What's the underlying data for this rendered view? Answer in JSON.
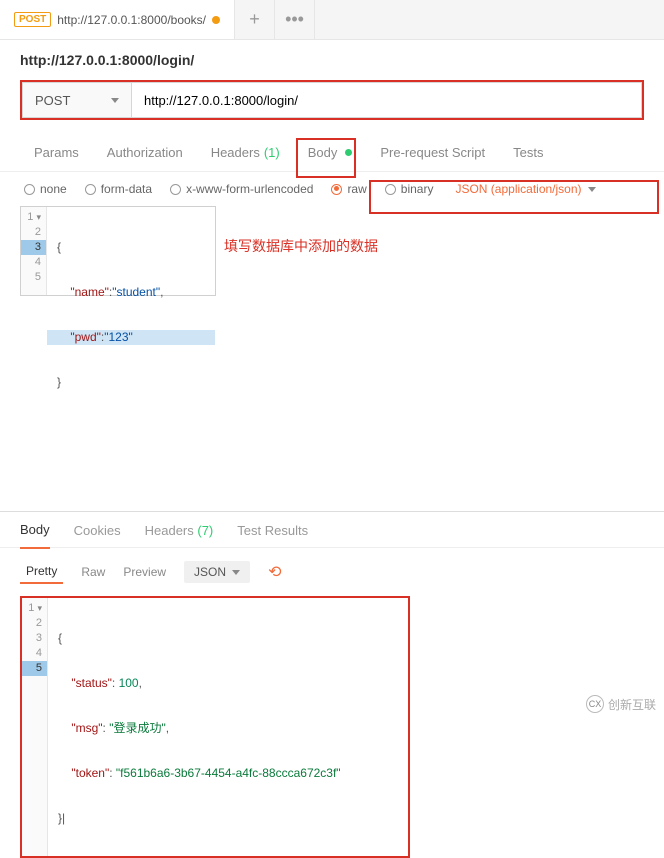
{
  "top_tab": {
    "method": "POST",
    "url": "http://127.0.0.1:8000/books/"
  },
  "subtitle": "http://127.0.0.1:8000/login/",
  "request": {
    "method": "POST",
    "url": "http://127.0.0.1:8000/login/"
  },
  "section_tabs": {
    "params": "Params",
    "auth": "Authorization",
    "headers": "Headers",
    "headers_count": "(1)",
    "body": "Body",
    "prerequest": "Pre-request Script",
    "tests": "Tests"
  },
  "body_types": {
    "none": "none",
    "formdata": "form-data",
    "xform": "x-www-form-urlencoded",
    "raw": "raw",
    "binary": "binary",
    "content_type": "JSON (application/json)"
  },
  "request_body": {
    "l1": "{",
    "l2_key": "\"name\"",
    "l2_val": "\"student\"",
    "l3_key": "\"pwd\"",
    "l3_val": "\"123\"",
    "l4": "}"
  },
  "annotation": "填写数据库中添加的数据",
  "response_tabs": {
    "body": "Body",
    "cookies": "Cookies",
    "headers": "Headers",
    "headers_count": "(7)",
    "testresults": "Test Results"
  },
  "toolbar": {
    "pretty": "Pretty",
    "raw": "Raw",
    "preview": "Preview",
    "json": "JSON"
  },
  "response_body": {
    "l1": "{",
    "l2_k": "\"status\"",
    "l2_v": "100",
    "l3_k": "\"msg\"",
    "l3_v": "\"登录成功\"",
    "l4_k": "\"token\"",
    "l4_v": "\"f561b6a6-3b67-4454-a4fc-88ccca672c3f\"",
    "l5": "}"
  },
  "watermark": "创新互联"
}
